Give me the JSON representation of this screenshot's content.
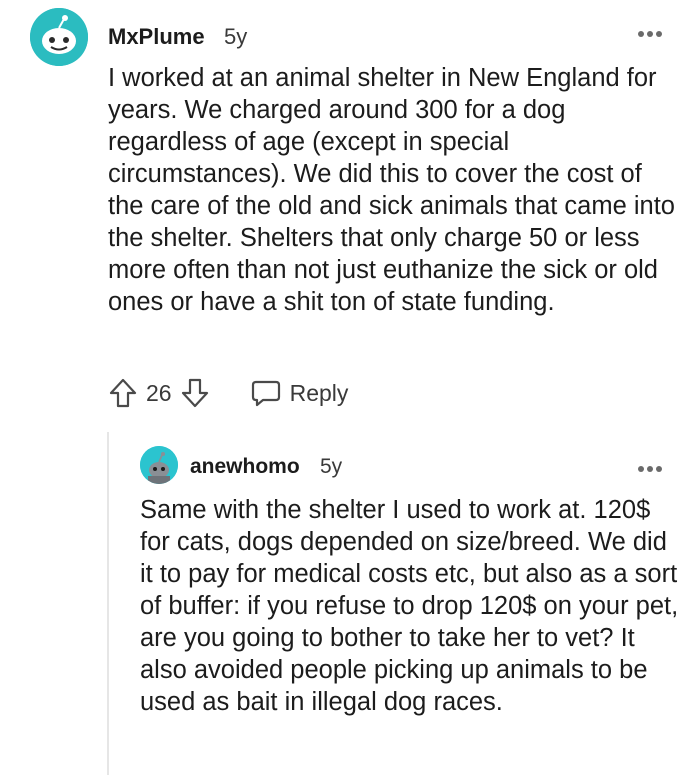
{
  "comment": {
    "author": "MxPlume",
    "age": "5y",
    "body": "I worked at an animal shelter in New England for years. We charged around 300 for a dog regardless of age (except in special circumstances). We did this to cover the cost of the care of the old and sick animals that came into the shelter. Shelters that only charge 50 or less more often than not just euthanize the sick or old ones or have a shit ton of state funding.",
    "score": "26",
    "reply_label": "Reply",
    "avatar_color": "#2bbcc0"
  },
  "reply": {
    "author": "anewhomo",
    "age": "5y",
    "body": "Same with the shelter I used to work at. 120$ for cats, dogs depended on size/breed. We did it to pay for medical costs etc, but also as a sort of buffer: if you refuse to drop 120$ on your pet, are you going to bother to take her to vet? It also avoided people picking up animals to be used as bait in illegal dog races.",
    "avatar_color": "#2bc4cf"
  },
  "icons": {
    "upvote": "arrow-up-icon",
    "downvote": "arrow-down-icon",
    "reply": "speech-bubble-icon",
    "more": "more-dots-icon",
    "avatar": "snoo-avatar-icon"
  }
}
